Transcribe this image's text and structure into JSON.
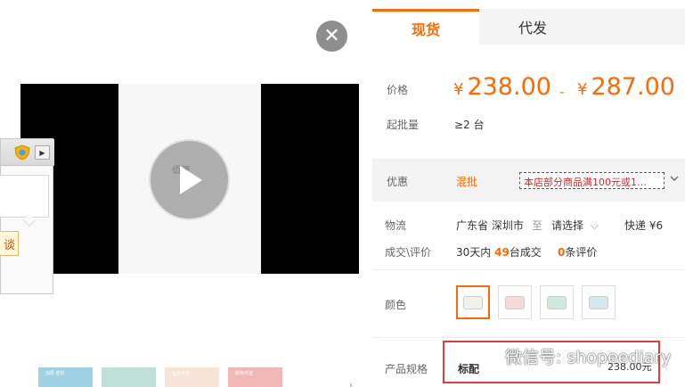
{
  "media": {
    "close_icon": "✕",
    "brand_text": "佰源",
    "popup": {
      "action_label": "谈"
    },
    "thumbnails": [
      {
        "color": "#9fd0e3",
        "caption": "加厚 密封"
      },
      {
        "color": "#bfe0d7",
        "caption": ""
      },
      {
        "color": "#f7e3d8",
        "caption": "全身水洗"
      },
      {
        "color": "#f2b8b8",
        "caption": "颜色可选"
      }
    ]
  },
  "tabs": [
    {
      "label": "现货",
      "active": true
    },
    {
      "label": "代发",
      "active": false
    }
  ],
  "price": {
    "label": "价格",
    "currency": "¥",
    "low": "238.00",
    "separator": "-",
    "high": "287.00"
  },
  "moq": {
    "label": "起批量",
    "value": "≥2 台"
  },
  "promo": {
    "label": "优惠",
    "tag": "混批",
    "text": "本店部分商品满100元或1…"
  },
  "shipping": {
    "label": "物流",
    "from": "广东省 深圳市",
    "to": "至",
    "select": "请选择",
    "method": "快递 ¥6"
  },
  "deals": {
    "label": "成交\\评价",
    "prefix": "30天内",
    "count": "49",
    "suffix": "台成交",
    "review_count": "0",
    "review_suffix": "条评价"
  },
  "color": {
    "label": "颜色",
    "options": [
      {
        "tint": "#f3f1ee",
        "selected": true
      },
      {
        "tint": "#f6d9d9",
        "selected": false
      },
      {
        "tint": "#cfe9df",
        "selected": false
      },
      {
        "tint": "#d5e8f0",
        "selected": false
      }
    ]
  },
  "spec": {
    "label": "产品规格",
    "name": "标配",
    "price": "238.00元"
  },
  "watermark": {
    "text": "微信号: shopeediary"
  },
  "colors": {
    "accent": "#ff6a00",
    "red": "#e53b3b"
  }
}
